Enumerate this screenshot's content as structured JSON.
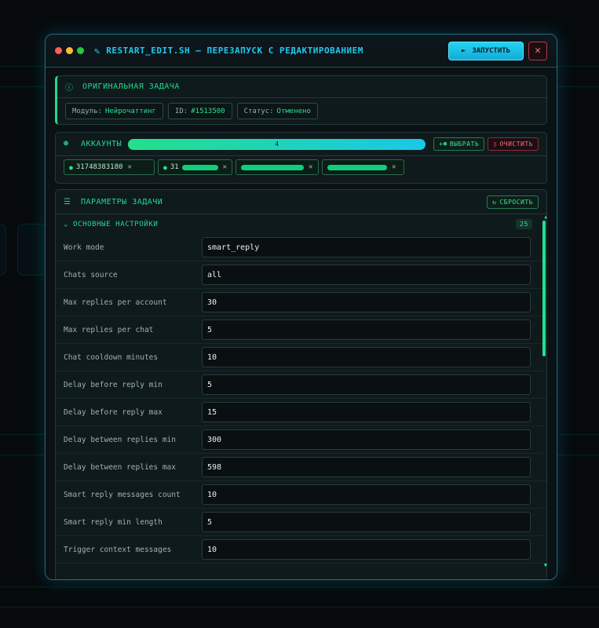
{
  "window": {
    "title": "RESTART_EDIT.SH",
    "subtitle": "— ПЕРЕЗАПУСК С РЕДАКТИРОВАНИЕМ",
    "run_label": "ЗАПУСТИТЬ",
    "close_glyph": "✕"
  },
  "original_task": {
    "heading": "ОРИГИНАЛЬНАЯ ЗАДАЧА",
    "module_label": "Модуль:",
    "module_value": "Нейрочаттинг",
    "id_label": "ID:",
    "id_value": "#1513500",
    "status_label": "Статус:",
    "status_value": "Отменено"
  },
  "accounts": {
    "heading": "АККАУНТЫ",
    "count": "4",
    "progress_fraction": 1.0,
    "select_label": "ВЫБРАТЬ",
    "clear_label": "ОЧИСТИТЬ",
    "items": [
      {
        "label": "31748383180"
      },
      {
        "label": "31"
      },
      {
        "label": ""
      },
      {
        "label": ""
      }
    ],
    "remove_glyph": "✕"
  },
  "params": {
    "heading": "ПАРАМЕТРЫ ЗАДАЧИ",
    "reset_label": "СБРОСИТЬ",
    "section_title": "ОСНОВНЫЕ НАСТРОЙКИ",
    "section_count": "25",
    "rows": [
      {
        "label": "Work mode",
        "value": "smart_reply"
      },
      {
        "label": "Chats source",
        "value": "all"
      },
      {
        "label": "Max replies per account",
        "value": "30"
      },
      {
        "label": "Max replies per chat",
        "value": "5"
      },
      {
        "label": "Chat cooldown minutes",
        "value": "10"
      },
      {
        "label": "Delay before reply min",
        "value": "5"
      },
      {
        "label": "Delay before reply max",
        "value": "15"
      },
      {
        "label": "Delay between replies min",
        "value": "300"
      },
      {
        "label": "Delay between replies max",
        "value": "598"
      },
      {
        "label": "Smart reply messages count",
        "value": "10"
      },
      {
        "label": "Smart reply min length",
        "value": "5"
      },
      {
        "label": "Trigger context messages",
        "value": "10"
      }
    ]
  },
  "colors": {
    "accent_green": "#22d98e",
    "accent_cyan": "#22c8ee",
    "danger": "#ff6a80"
  }
}
